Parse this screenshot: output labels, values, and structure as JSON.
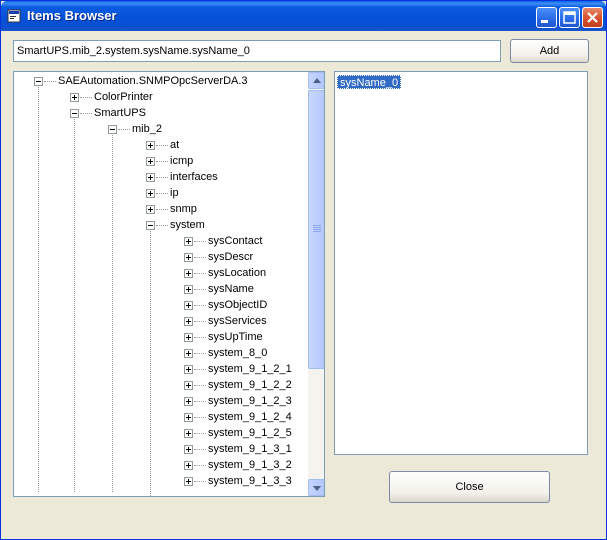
{
  "window": {
    "title": "Items Browser"
  },
  "item_path": {
    "value": "SmartUPS.mib_2.system.sysName.sysName_0"
  },
  "buttons": {
    "add": "Add",
    "close": "Close"
  },
  "tree": [
    {
      "label": "SAEAutomation.SNMPOpcServerDA.3",
      "level": 0,
      "state": "expanded"
    },
    {
      "label": "ColorPrinter",
      "level": 1,
      "state": "collapsed"
    },
    {
      "label": "SmartUPS",
      "level": 1,
      "state": "expanded"
    },
    {
      "label": "mib_2",
      "level": 2,
      "state": "expanded"
    },
    {
      "label": "at",
      "level": 3,
      "state": "collapsed"
    },
    {
      "label": "icmp",
      "level": 3,
      "state": "collapsed"
    },
    {
      "label": "interfaces",
      "level": 3,
      "state": "collapsed"
    },
    {
      "label": "ip",
      "level": 3,
      "state": "collapsed"
    },
    {
      "label": "snmp",
      "level": 3,
      "state": "collapsed"
    },
    {
      "label": "system",
      "level": 3,
      "state": "expanded"
    },
    {
      "label": "sysContact",
      "level": 4,
      "state": "collapsed"
    },
    {
      "label": "sysDescr",
      "level": 4,
      "state": "collapsed"
    },
    {
      "label": "sysLocation",
      "level": 4,
      "state": "collapsed"
    },
    {
      "label": "sysName",
      "level": 4,
      "state": "collapsed"
    },
    {
      "label": "sysObjectID",
      "level": 4,
      "state": "collapsed"
    },
    {
      "label": "sysServices",
      "level": 4,
      "state": "collapsed"
    },
    {
      "label": "sysUpTime",
      "level": 4,
      "state": "collapsed"
    },
    {
      "label": "system_8_0",
      "level": 4,
      "state": "collapsed"
    },
    {
      "label": "system_9_1_2_1",
      "level": 4,
      "state": "collapsed"
    },
    {
      "label": "system_9_1_2_2",
      "level": 4,
      "state": "collapsed"
    },
    {
      "label": "system_9_1_2_3",
      "level": 4,
      "state": "collapsed"
    },
    {
      "label": "system_9_1_2_4",
      "level": 4,
      "state": "collapsed"
    },
    {
      "label": "system_9_1_2_5",
      "level": 4,
      "state": "collapsed"
    },
    {
      "label": "system_9_1_3_1",
      "level": 4,
      "state": "collapsed"
    },
    {
      "label": "system_9_1_3_2",
      "level": 4,
      "state": "collapsed"
    },
    {
      "label": "system_9_1_3_3",
      "level": 4,
      "state": "collapsed"
    }
  ],
  "items_list": [
    "sysName_0"
  ],
  "colors": {
    "selection": "#316ac5",
    "titlebar": "#0a5fe8"
  }
}
